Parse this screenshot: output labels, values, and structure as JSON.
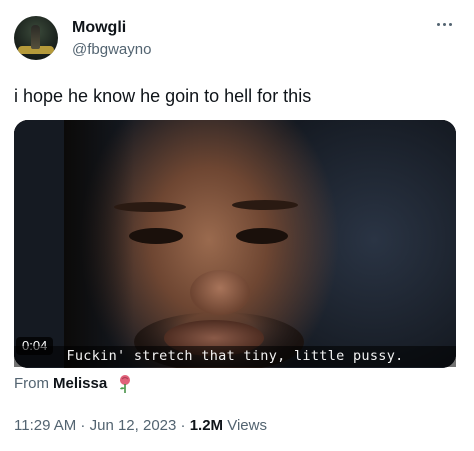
{
  "author": {
    "name": "Mowgli",
    "handle": "@fbgwayno"
  },
  "tweet": {
    "text": "i hope he know he goin to hell for this"
  },
  "media": {
    "duration": "0:04",
    "subtitle": "Fuckin' stretch that tiny, little pussy."
  },
  "source": {
    "prefix": "From",
    "name": "Melissa",
    "icon": "rose-icon"
  },
  "meta": {
    "time": "11:29 AM",
    "sep1": " · ",
    "date": "Jun 12, 2023",
    "sep2": " · ",
    "views_count": "1.2M",
    "views_label": " Views"
  },
  "icons": {
    "more": "more-icon"
  },
  "colors": {
    "text": "#0f1419",
    "secondary": "#536471"
  }
}
